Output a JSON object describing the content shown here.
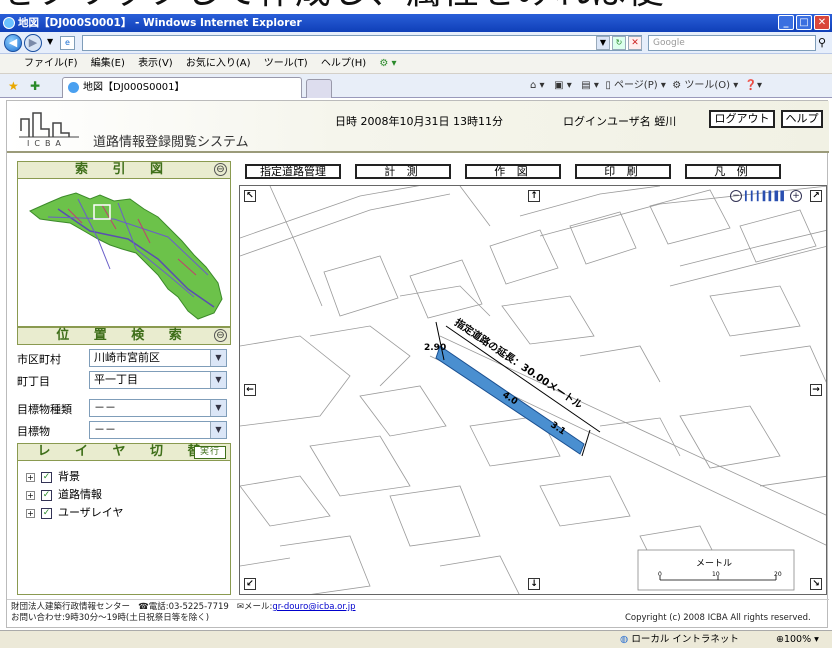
{
  "overlay_caption": "をクリックして作成し、属性をみれば便",
  "window": {
    "title": "地図【DJ000S0001】 - Windows Internet Explorer"
  },
  "nav": {
    "address": "",
    "search_placeholder": "Google"
  },
  "menu": [
    "ファイル(F)",
    "編集(E)",
    "表示(V)",
    "お気に入り(A)",
    "ツール(T)",
    "ヘルプ(H)"
  ],
  "tab": {
    "label": "地図【DJ000S0001】"
  },
  "commands": {
    "page": "ページ(P)",
    "tools": "ツール(O)"
  },
  "header": {
    "logo_text": "ICBA",
    "system_title": "道路情報登録閲覧システム",
    "datetime": "日時  2008年10月31日 13時11分",
    "user": "ログインユーザ名  蛭川",
    "logout": "ログアウト",
    "help": "ヘルプ"
  },
  "sections": {
    "index_map": "索 引 図",
    "location_search": "位 置 検 索",
    "layer_switch": "レ イ ヤ 切 替",
    "exec_label": "実行"
  },
  "search_fields": [
    {
      "label": "市区町村",
      "value": "川崎市宮前区"
    },
    {
      "label": "町丁目",
      "value": "平一丁目"
    },
    {
      "label": "目標物種類",
      "value": "－－"
    },
    {
      "label": "目標物",
      "value": "－－"
    }
  ],
  "layers": [
    {
      "label": "背景",
      "checked": true
    },
    {
      "label": "道路情報",
      "checked": true
    },
    {
      "label": "ユーザレイヤ",
      "checked": true
    }
  ],
  "map_buttons": [
    "指定道路管理",
    "計 測",
    "作 図",
    "印 刷",
    "凡 例"
  ],
  "map": {
    "road_label": "指定道路の延長：30.00メートル",
    "width_start": "2.90",
    "width_mid": "4.0",
    "width_end": "3.1",
    "scale_unit": "メートル",
    "scale_ticks": [
      "0",
      "10",
      "20"
    ]
  },
  "footer": {
    "org": "財団法人建築行政情報センター",
    "phone": "☎電話:03-5225-7719",
    "mail_label": "✉メール:",
    "mail": "gr-douro@icba.or.jp",
    "hours": "お問い合わせ:9時30分～19時(土日祝祭日等を除く)",
    "copyright": "Copyright (c) 2008 ICBA All rights reserved."
  },
  "status": {
    "zone": "ローカル イントラネット",
    "zoom": "100%"
  },
  "colors": {
    "titlebar": "#1e50c8",
    "section_green": "#3f6f1a",
    "road_fill": "#4a8fd0",
    "minimap_green": "#6cc24a"
  }
}
